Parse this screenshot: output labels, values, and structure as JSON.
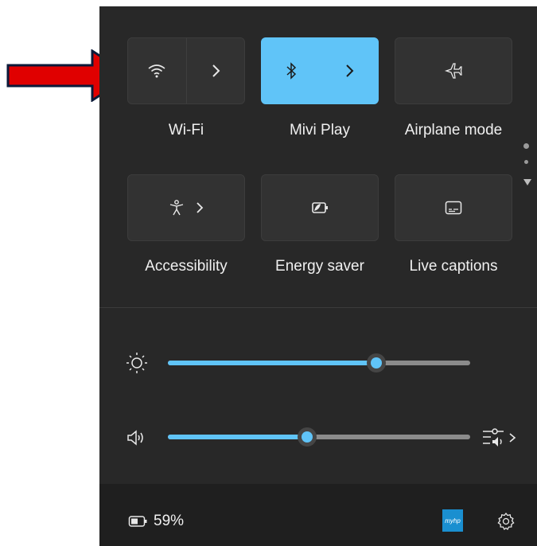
{
  "tiles": {
    "wifi": {
      "label": "Wi-Fi",
      "icon": "wifi-icon",
      "state": "off"
    },
    "bluetooth": {
      "label": "Mivi Play",
      "icon": "bluetooth-icon",
      "state": "on"
    },
    "airplane": {
      "label": "Airplane mode",
      "icon": "airplane-icon",
      "state": "off"
    },
    "accessibility": {
      "label": "Accessibility",
      "icon": "accessibility-icon"
    },
    "energy_saver": {
      "label": "Energy saver",
      "icon": "energy-saver-icon"
    },
    "live_captions": {
      "label": "Live captions",
      "icon": "captions-icon"
    }
  },
  "sliders": {
    "brightness": {
      "icon": "brightness-icon",
      "level": 0.69
    },
    "volume": {
      "icon": "volume-icon",
      "level": 0.46
    }
  },
  "footer": {
    "battery_text": "59%",
    "battery_icon": "battery-icon",
    "logo_text": "myhp",
    "settings_icon": "gear-icon"
  },
  "colors": {
    "accent": "#60c4f8",
    "panel": "#282828",
    "arrow": "#e00000"
  }
}
